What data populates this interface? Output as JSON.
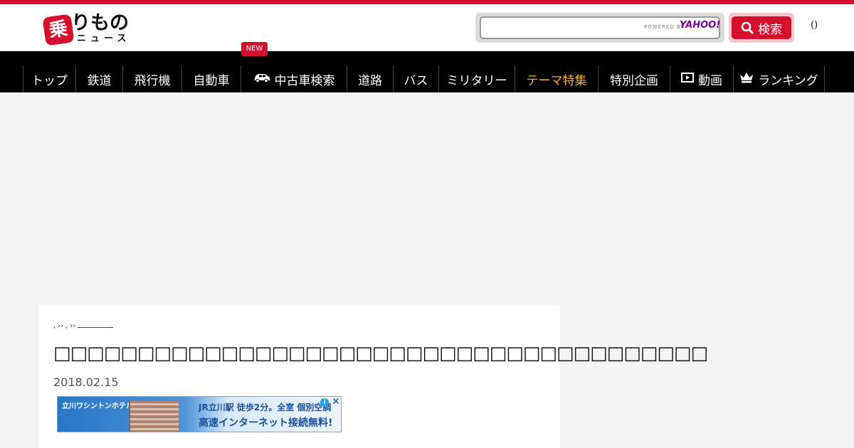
{
  "header": {
    "logo_mark": "乗",
    "logo_main": "りもの",
    "logo_sub": "ニュース",
    "search": {
      "value": "",
      "powered_by": "POWERED BY",
      "provider": "YAHOO!",
      "button_label": "検索"
    },
    "paren": "()"
  },
  "nav": {
    "new_badge": "NEW",
    "items": [
      {
        "label": "トップ",
        "icon": null
      },
      {
        "label": "鉄道",
        "icon": null
      },
      {
        "label": "飛行機",
        "icon": null
      },
      {
        "label": "自動車",
        "icon": null
      },
      {
        "label": "中古車検索",
        "icon": "car-icon"
      },
      {
        "label": "道路",
        "icon": null
      },
      {
        "label": "バス",
        "icon": null
      },
      {
        "label": "ミリタリー",
        "icon": null
      },
      {
        "label": "テーマ特集",
        "icon": null
      },
      {
        "label": "特別企画",
        "icon": null
      },
      {
        "label": "動画",
        "icon": "video-icon"
      },
      {
        "label": "ランキング",
        "icon": "crown-icon"
      }
    ],
    "active_index": 8
  },
  "article": {
    "breadcrumb": [
      ",",
      "››",
      ",",
      "››"
    ],
    "title": "□□□□□□□□□□□□□□□□□□□□□□□□□□□□□□□□□□□□□□□",
    "date": "2018.02.15"
  },
  "ad": {
    "brand": "立川ワシントンホテル",
    "line1": "JR立川駅 徒歩2分。全室 個別空調",
    "line2": "高速インターネット接続無料!",
    "adchoice_icon": "info-icon",
    "close_label": "✕"
  },
  "colors": {
    "brand_red": "#d5102e",
    "nav_bg": "#000000",
    "nav_active": "#f3b13c",
    "page_bg": "#f4f4f4"
  }
}
